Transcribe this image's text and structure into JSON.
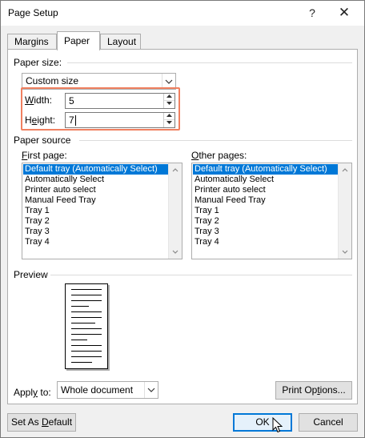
{
  "window": {
    "title": "Page Setup",
    "help_glyph": "?",
    "close_glyph": "✕"
  },
  "tabs": [
    {
      "label": "Margins",
      "active": false
    },
    {
      "label": "Paper",
      "active": true
    },
    {
      "label": "Layout",
      "active": false
    }
  ],
  "paper_size": {
    "group_label": "Paper size:",
    "selected": "Custom size",
    "width_label_u": "W",
    "width_label_rest": "idth:",
    "width_value": "5",
    "height_label_pre": "H",
    "height_label_u": "e",
    "height_label_rest": "ight:",
    "height_value": "7",
    "highlight_color": "#f08060"
  },
  "paper_source": {
    "group_label": "Paper source",
    "first_page_label_u": "F",
    "first_page_label_rest": "irst page:",
    "other_pages_label_u": "O",
    "other_pages_label_rest": "ther pages:",
    "first_page_items": [
      "Default tray (Automatically Select)",
      "Automatically Select",
      "Printer auto select",
      "Manual Feed Tray",
      "Tray 1",
      "Tray 2",
      "Tray 3",
      "Tray 4"
    ],
    "other_pages_items": [
      "Default tray (Automatically Select)",
      "Automatically Select",
      "Printer auto select",
      "Manual Feed Tray",
      "Tray 1",
      "Tray 2",
      "Tray 3",
      "Tray 4"
    ],
    "selected_color": "#0078d7"
  },
  "preview": {
    "group_label": "Preview",
    "apply_to_label_pre": "Appl",
    "apply_to_label_u": "y",
    "apply_to_label_rest": " to:",
    "apply_to_value": "Whole document",
    "print_options_pre": "Print Op",
    "print_options_u": "t",
    "print_options_rest": "ions..."
  },
  "footer": {
    "set_default_pre": "Set As ",
    "set_default_u": "D",
    "set_default_rest": "efault",
    "ok_label": "OK",
    "cancel_label": "Cancel"
  },
  "icons": {
    "dropdown": "chevron-down-icon",
    "spin_up": "triangle-up-icon",
    "spin_down": "triangle-down-icon",
    "cursor": "mouse-pointer-icon"
  }
}
